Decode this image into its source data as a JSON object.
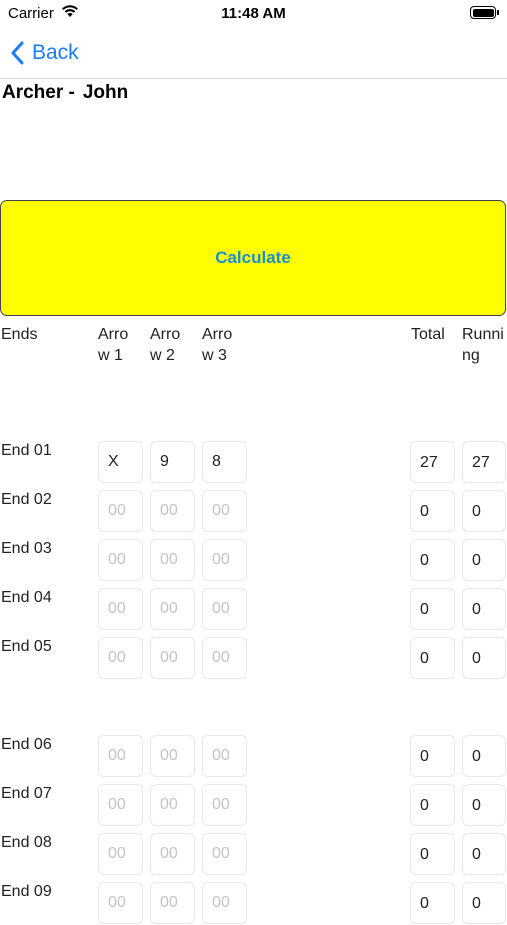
{
  "status_bar": {
    "carrier": "Carrier",
    "time": "11:48 AM",
    "icons": [
      "wifi-icon",
      "battery-icon"
    ]
  },
  "nav": {
    "back_label": "Back",
    "back_icon": "chevron-left-icon",
    "accent": "#1a7cf5"
  },
  "archer": {
    "label": "Archer -",
    "name": "John"
  },
  "calculate": {
    "label": "Calculate",
    "background": "#ffff00",
    "text_color": "#1a8fc9"
  },
  "headers": {
    "ends": "Ends",
    "arrow1": [
      "Arro",
      "w 1"
    ],
    "arrow2": [
      "Arro",
      "w 2"
    ],
    "arrow3": [
      "Arro",
      "w 3"
    ],
    "total": "Total",
    "running": [
      "Runni",
      "ng"
    ]
  },
  "arrow_placeholder": "00",
  "ends": [
    {
      "label": "End 01",
      "arrows": [
        "X",
        "9",
        "8"
      ],
      "total": "27",
      "running": "27"
    },
    {
      "label": "End 02",
      "arrows": [
        "",
        "",
        ""
      ],
      "total": "0",
      "running": "0"
    },
    {
      "label": "End 03",
      "arrows": [
        "",
        "",
        ""
      ],
      "total": "0",
      "running": "0"
    },
    {
      "label": "End 04",
      "arrows": [
        "",
        "",
        ""
      ],
      "total": "0",
      "running": "0"
    },
    {
      "label": "End 05",
      "arrows": [
        "",
        "",
        ""
      ],
      "total": "0",
      "running": "0"
    },
    {
      "label": "End 06",
      "arrows": [
        "",
        "",
        ""
      ],
      "total": "0",
      "running": "0"
    },
    {
      "label": "End 07",
      "arrows": [
        "",
        "",
        ""
      ],
      "total": "0",
      "running": "0"
    },
    {
      "label": "End 08",
      "arrows": [
        "",
        "",
        ""
      ],
      "total": "0",
      "running": "0"
    },
    {
      "label": "End 09",
      "arrows": [
        "",
        "",
        ""
      ],
      "total": "0",
      "running": "0"
    }
  ]
}
